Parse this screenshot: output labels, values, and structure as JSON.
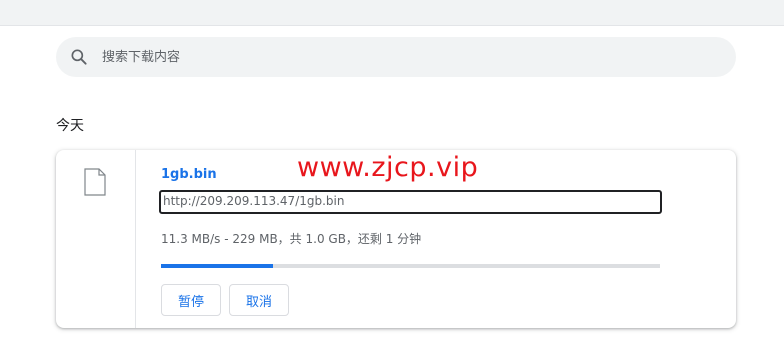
{
  "search": {
    "placeholder": "搜索下载内容",
    "icon": "search-icon"
  },
  "section": {
    "title": "今天"
  },
  "download": {
    "file_icon": "file-icon",
    "filename": "1gb.bin",
    "url": "http://209.209.113.47/1gb.bin",
    "status": "11.3 MB/s - 229 MB，共 1.0 GB，还剩 1 分钟",
    "progress": 0.224,
    "pause_label": "暂停",
    "cancel_label": "取消"
  },
  "watermark": {
    "text": "www.zjcp.vip"
  },
  "colors": {
    "accent": "#1a73e8",
    "watermark": "#e8161c",
    "track": "#dcdee1"
  }
}
